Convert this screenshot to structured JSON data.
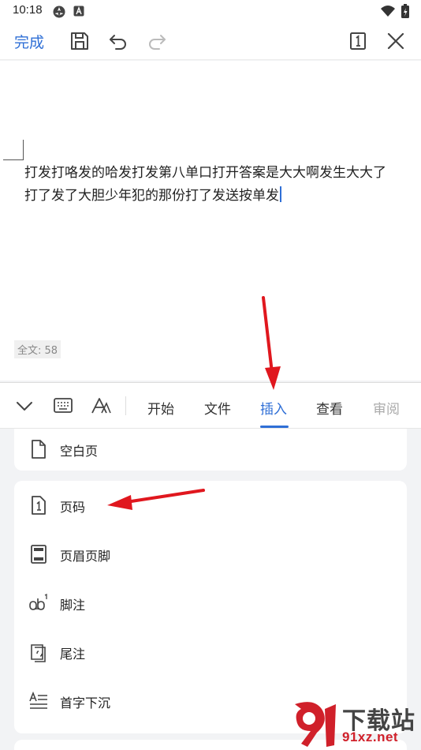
{
  "status_bar": {
    "time": "10:18"
  },
  "toolbar": {
    "done_label": "完成"
  },
  "document": {
    "line1": "打发打咯发的哈发打发第八单口打开答案是大大啊发生大大了",
    "line2": "打了发了大胆少年犯的那份打了发送按单发",
    "word_count": "全文: 58"
  },
  "tabs": [
    {
      "label": "开始"
    },
    {
      "label": "文件"
    },
    {
      "label": "插入",
      "active": true
    },
    {
      "label": "查看"
    },
    {
      "label": "审阅"
    }
  ],
  "insert_menu": {
    "blank_page": "空白页",
    "page_number": "页码",
    "header_footer": "页眉页脚",
    "footnote": "脚注",
    "endnote": "尾注",
    "drop_cap": "首字下沉"
  },
  "watermark": {
    "brand": "下载站",
    "url": "91xz.net"
  },
  "colors": {
    "accent": "#2f6fd6",
    "annotation_arrow": "#e0171e"
  }
}
